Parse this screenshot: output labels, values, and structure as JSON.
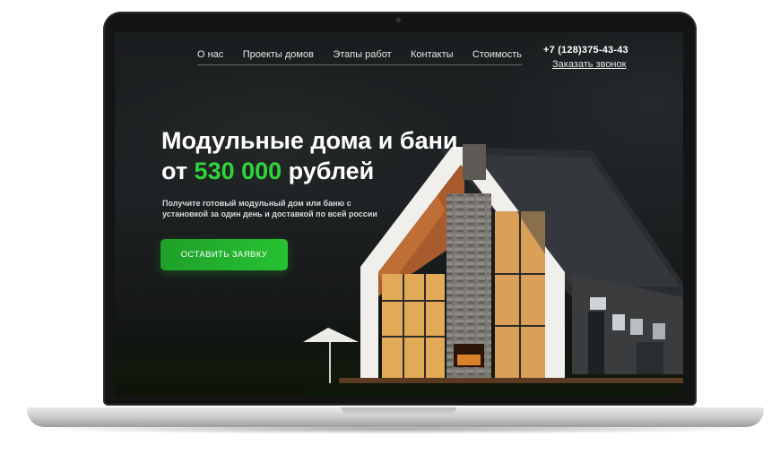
{
  "nav": {
    "links": [
      "О нас",
      "Проекты домов",
      "Этапы работ",
      "Контакты",
      "Стоимость"
    ],
    "phone": "+7 (128)375-43-43",
    "callback": "Заказать звонок"
  },
  "hero": {
    "title_line1": "Модульные дома и бани",
    "title_prefix": "от ",
    "price": "530 000",
    "title_suffix": " рублей",
    "subtitle": "Получите готовый модульный дом или баню с установкой  за один день и доставкой по всей россии",
    "cta": "ОСТАВИТЬ ЗАЯВКУ"
  },
  "colors": {
    "accent": "#2ed43a",
    "cta_bg": "#22b02e",
    "screen_bg": "#1c1f20"
  }
}
